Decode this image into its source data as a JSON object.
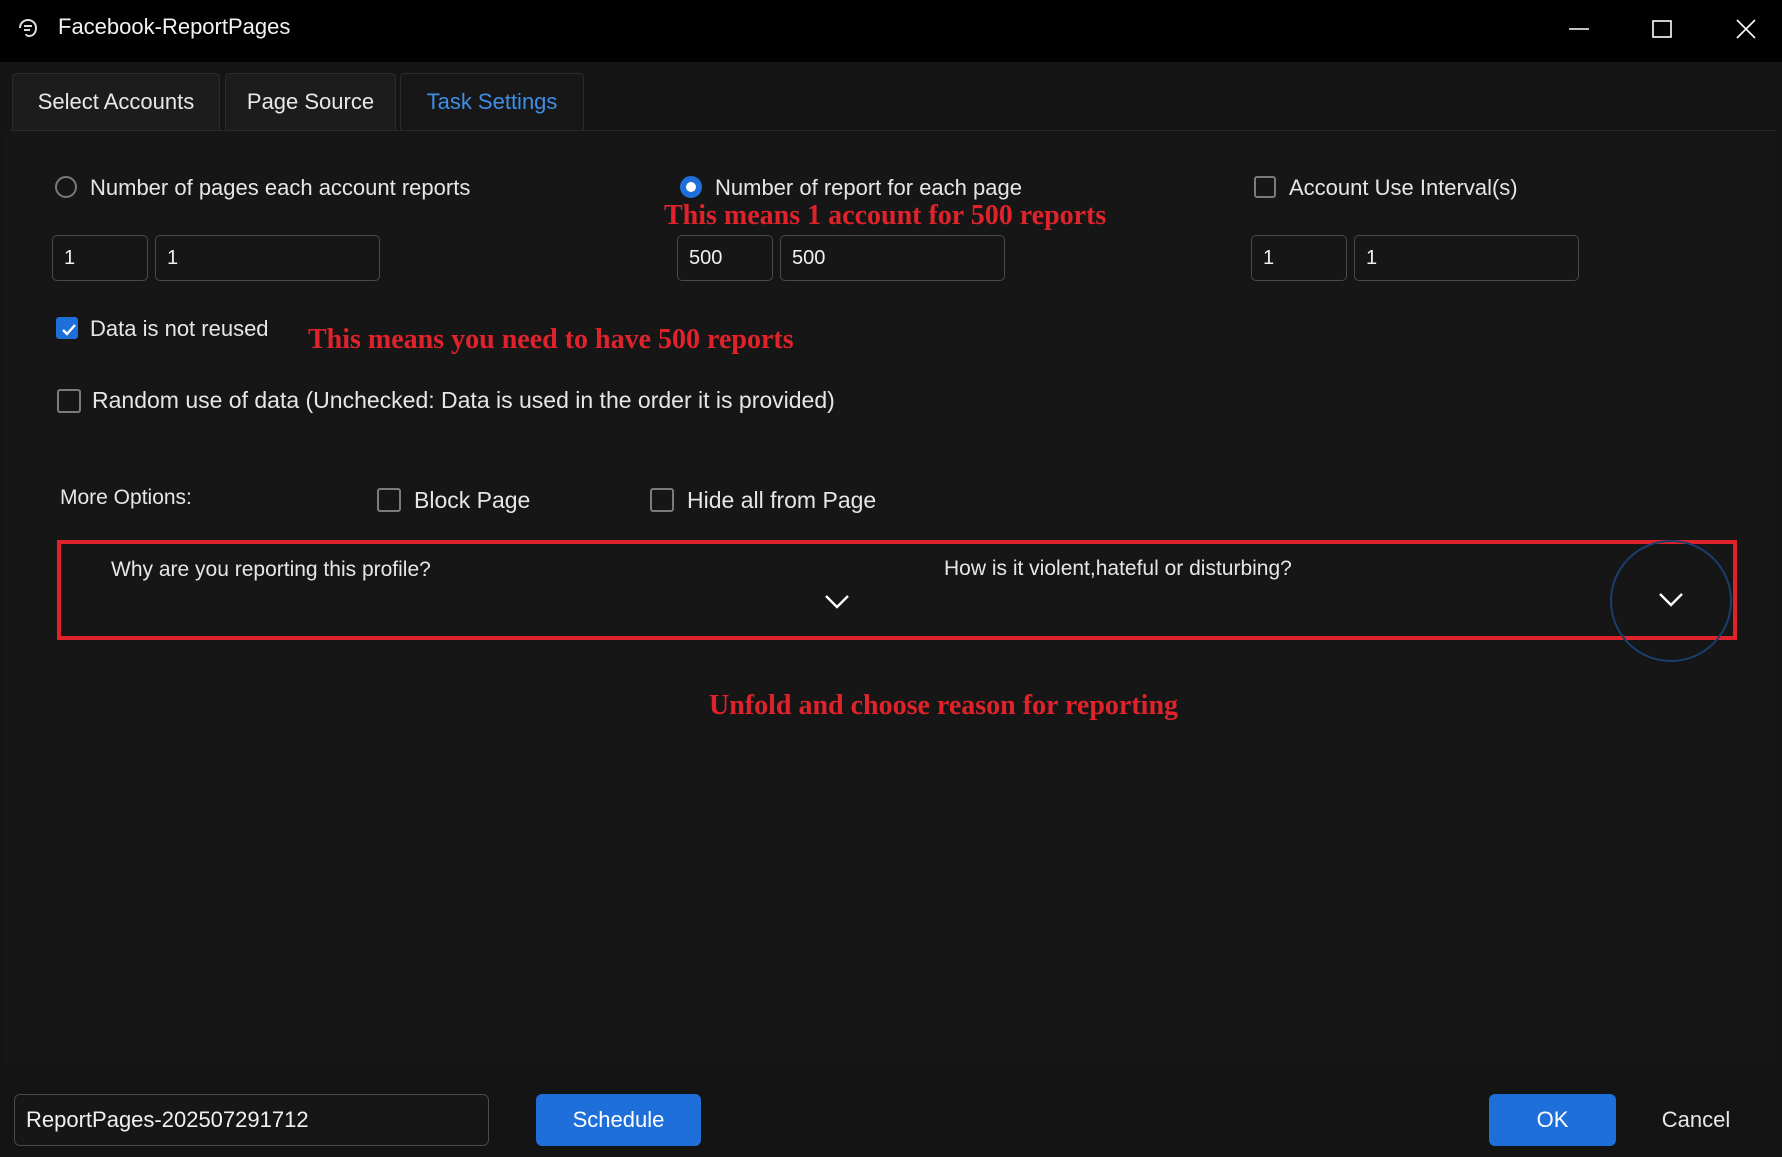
{
  "window": {
    "title": "Facebook-ReportPages",
    "icon": "app-logo-icon",
    "controls": [
      "minimize-icon",
      "maximize-icon",
      "close-icon"
    ]
  },
  "tabs": [
    {
      "label": "Select Accounts",
      "active": false
    },
    {
      "label": "Page Source",
      "active": false
    },
    {
      "label": "Task Settings",
      "active": true
    }
  ],
  "settings": {
    "pages_per_account": {
      "label": "Number of pages each account reports",
      "selected": false,
      "min": "1",
      "max": "1"
    },
    "reports_per_page": {
      "label": "Number of report for each page",
      "selected": true,
      "min": "500",
      "max": "500"
    },
    "account_interval": {
      "label": "Account Use Interval(s)",
      "checked": false,
      "min": "1",
      "max": "1"
    },
    "data_not_reused": {
      "label": "Data is not reused",
      "checked": true
    },
    "random_use": {
      "label": "Random use of data (Unchecked: Data is used in the order it is provided)",
      "checked": false
    }
  },
  "more_options": {
    "label": "More Options:",
    "block_page": {
      "label": "Block Page",
      "checked": false
    },
    "hide_all": {
      "label": "Hide all from Page",
      "checked": false
    }
  },
  "reason": {
    "question1": "Why are you reporting this profile?",
    "question2": "How is it violent,hateful or disturbing?"
  },
  "annotations": {
    "note1": "This means 1 account for 500 reports",
    "note2": "This means you need to have 500 reports",
    "note3": "Unfold and  choose reason for reporting",
    "color": "#e0232b"
  },
  "footer": {
    "task_name": "ReportPages-202507291712",
    "schedule_label": "Schedule",
    "ok_label": "OK",
    "cancel_label": "Cancel"
  },
  "colors": {
    "accent": "#1e6fd9",
    "background": "#141414",
    "titlebar": "#000000"
  }
}
